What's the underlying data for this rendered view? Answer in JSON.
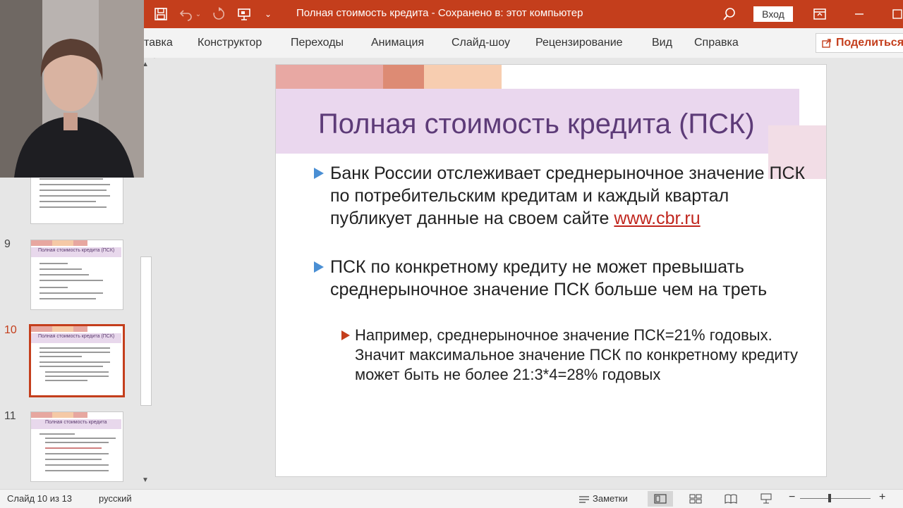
{
  "titlebar": {
    "doc_title": "Полная стоимость кредита  -  Сохранено в: этот компьютер",
    "signin_label": "Вход"
  },
  "ribbon": {
    "tabs": [
      "тавка",
      "Конструктор",
      "Переходы",
      "Анимация",
      "Слайд-шоу",
      "Рецензирование",
      "Вид",
      "Справка"
    ],
    "share_label": "Поделиться"
  },
  "thumbnails": [
    {
      "number": "9",
      "title": "Полная стоимость кредита (ПСК)"
    },
    {
      "number": "10",
      "title": "Полная стоимость кредита (ПСК)"
    },
    {
      "number": "11",
      "title": "Полная стоимость кредита"
    }
  ],
  "slide": {
    "title": "Полная стоимость кредита (ПСК)",
    "bullet1_text": "Банк России отслеживает среднерыночное значение ПСК по потребительским кредитам и каждый квартал публикует данные на своем сайте ",
    "bullet1_link": "www.cbr.ru",
    "bullet2_text": "ПСК по конкретному кредиту не может превышать среднерыночное значение ПСК больше чем на треть",
    "sub_bullet_text": "Например, среднерыночное значение ПСК=21% годовых. Значит максимальное значение ПСК по конкретному кредиту может быть не более 21:3*4=28% годовых"
  },
  "statusbar": {
    "slide_counter": "Слайд 10 из 13",
    "language": "русский",
    "notes_label": "Заметки"
  },
  "colors": {
    "accent": "#c43e1c",
    "title_text": "#5d3b78",
    "bullet_marker": "#4a8fd4",
    "link": "#c0261e"
  }
}
